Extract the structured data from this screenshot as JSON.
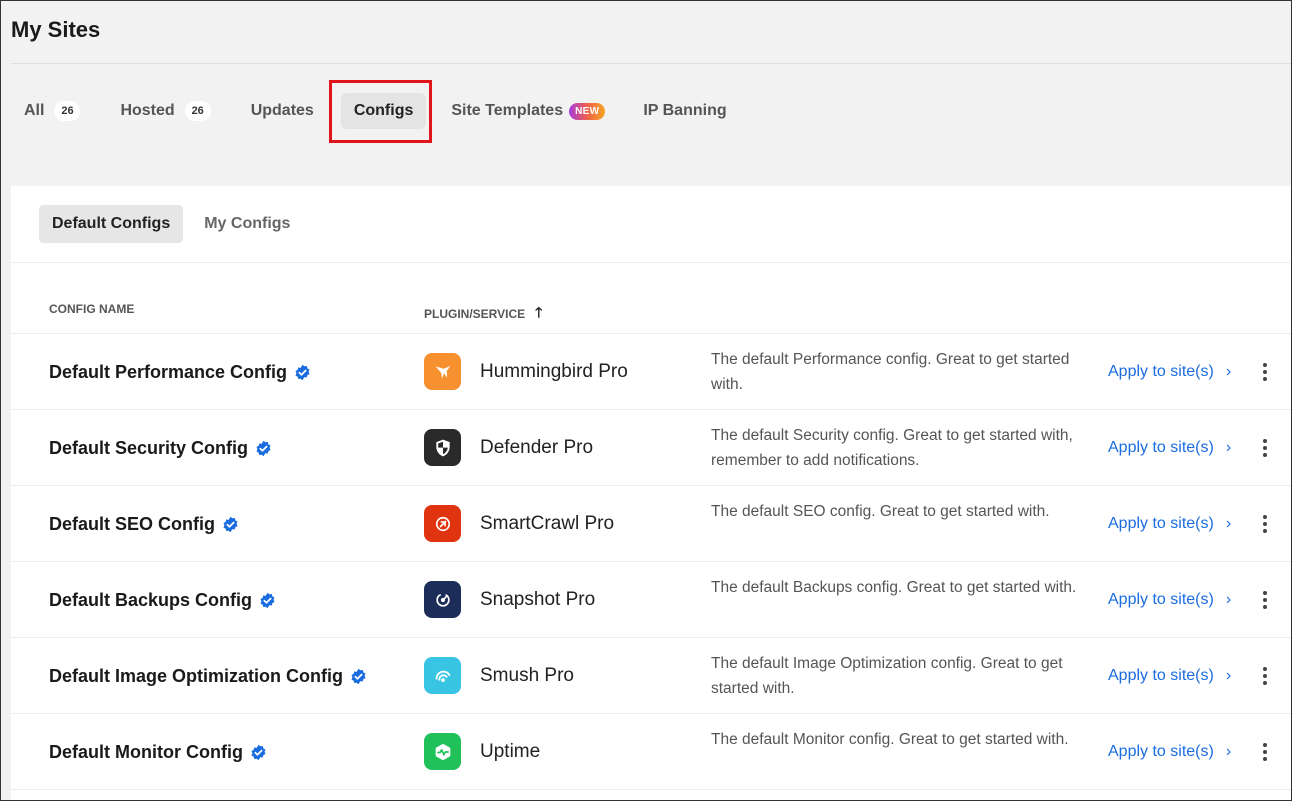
{
  "page": {
    "title": "My Sites"
  },
  "tabs": [
    {
      "label": "All",
      "count": "26"
    },
    {
      "label": "Hosted",
      "count": "26"
    },
    {
      "label": "Updates"
    },
    {
      "label": "Configs",
      "active": true
    },
    {
      "label": "Site Templates",
      "badge": "NEW"
    },
    {
      "label": "IP Banning"
    }
  ],
  "subtabs": [
    {
      "label": "Default Configs",
      "active": true
    },
    {
      "label": "My Configs"
    }
  ],
  "columns": {
    "config_name": "CONFIG NAME",
    "plugin_service": "PLUGIN/SERVICE"
  },
  "rows": [
    {
      "name": "Default Performance Config",
      "plugin": "Hummingbird Pro",
      "description": "The default Performance config. Great to get started with.",
      "action": "Apply to site(s)",
      "icon": "hummingbird-icon",
      "color": "#f7902f"
    },
    {
      "name": "Default Security Config",
      "plugin": "Defender Pro",
      "description": "The default Security config. Great to get started with, remember to add notifications.",
      "action": "Apply to site(s)",
      "icon": "defender-shield-icon",
      "color": "#2a2a2a"
    },
    {
      "name": "Default SEO Config",
      "plugin": "SmartCrawl Pro",
      "description": "The default SEO config. Great to get started with.",
      "action": "Apply to site(s)",
      "icon": "smartcrawl-icon",
      "color": "#e0330f"
    },
    {
      "name": "Default Backups Config",
      "plugin": "Snapshot Pro",
      "description": "The default Backups config. Great to get started with.",
      "action": "Apply to site(s)",
      "icon": "snapshot-icon",
      "color": "#1b2d58"
    },
    {
      "name": "Default Image Optimization Config",
      "plugin": "Smush Pro",
      "description": "The default Image Optimization config. Great to get started with.",
      "action": "Apply to site(s)",
      "icon": "smush-icon",
      "color": "#37c5e3"
    },
    {
      "name": "Default Monitor Config",
      "plugin": "Uptime",
      "description": "The default Monitor config. Great to get started with.",
      "action": "Apply to site(s)",
      "icon": "uptime-icon",
      "color": "#20c15a"
    }
  ],
  "colors": {
    "accent": "#1a6de0",
    "verified": "#1a6de0",
    "highlight": "#e2141b"
  }
}
